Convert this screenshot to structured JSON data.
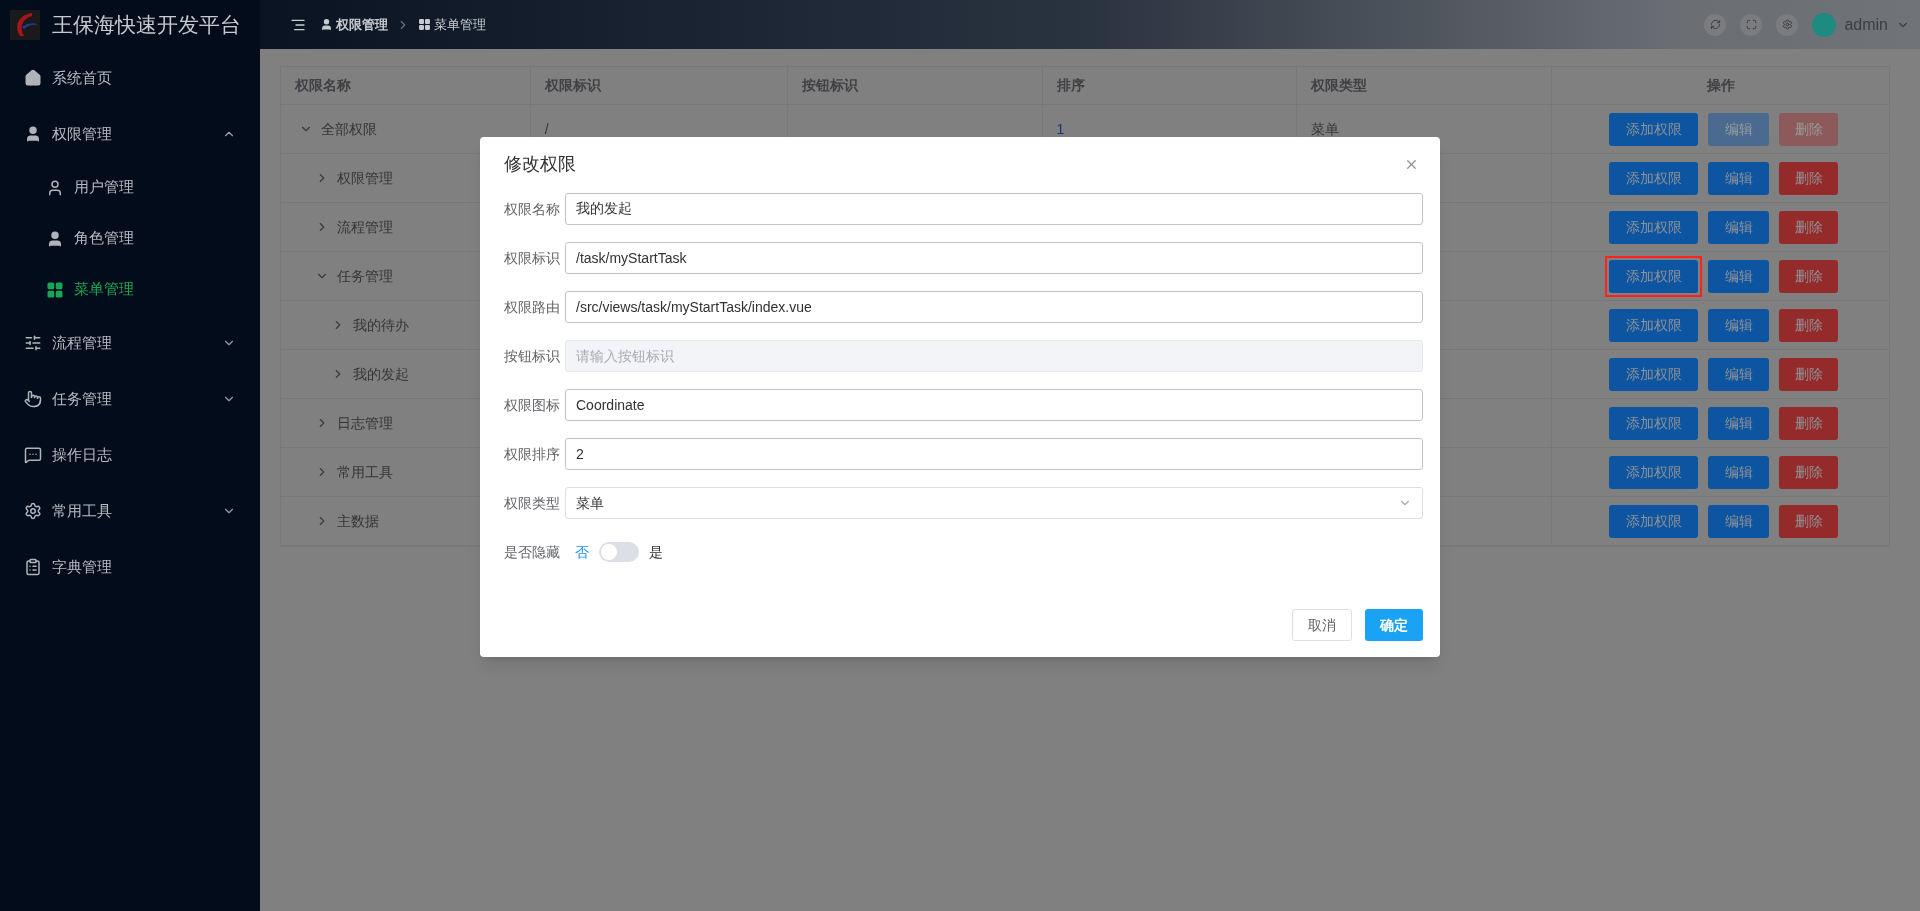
{
  "app": {
    "title": "王保海快速开发平台"
  },
  "header": {
    "breadcrumb": [
      "权限管理",
      "菜单管理"
    ],
    "user": "admin"
  },
  "sidebar": {
    "items": [
      {
        "label": "系统首页",
        "selected": false
      },
      {
        "label": "权限管理",
        "selected": false,
        "expanded": true,
        "children": [
          {
            "label": "用户管理",
            "selected": false
          },
          {
            "label": "角色管理",
            "selected": false
          },
          {
            "label": "菜单管理",
            "selected": true
          }
        ]
      },
      {
        "label": "流程管理",
        "selected": false,
        "expanded": false
      },
      {
        "label": "任务管理",
        "selected": false,
        "expanded": false
      },
      {
        "label": "操作日志",
        "selected": false
      },
      {
        "label": "常用工具",
        "selected": false,
        "expanded": false
      },
      {
        "label": "字典管理",
        "selected": false
      }
    ]
  },
  "table": {
    "columns": [
      "权限名称",
      "权限标识",
      "按钮标识",
      "排序",
      "权限类型",
      "操作"
    ],
    "rows": [
      {
        "name": "全部权限",
        "path": "/",
        "sort": "1",
        "type": "菜单",
        "expanded": true,
        "actions": [
          {
            "label": "添加权限",
            "kind": "add",
            "disabled": false,
            "highlighted": false
          },
          {
            "label": "编辑",
            "kind": "edit",
            "disabled": true,
            "highlighted": false
          },
          {
            "label": "删除",
            "kind": "delete",
            "disabled": true,
            "highlighted": false
          }
        ],
        "children": [
          {
            "name": "权限管理",
            "expanded": false,
            "actions": [
              {
                "label": "添加权限",
                "kind": "add",
                "disabled": false,
                "highlighted": false
              },
              {
                "label": "编辑",
                "kind": "edit",
                "disabled": false,
                "highlighted": false
              },
              {
                "label": "删除",
                "kind": "delete",
                "disabled": false,
                "highlighted": false
              }
            ]
          },
          {
            "name": "流程管理",
            "expanded": false,
            "actions": [
              {
                "label": "添加权限",
                "kind": "add",
                "disabled": false,
                "highlighted": false
              },
              {
                "label": "编辑",
                "kind": "edit",
                "disabled": false,
                "highlighted": false
              },
              {
                "label": "删除",
                "kind": "delete",
                "disabled": false,
                "highlighted": false
              }
            ]
          },
          {
            "name": "任务管理",
            "expanded": true,
            "actions": [
              {
                "label": "添加权限",
                "kind": "add",
                "disabled": false,
                "highlighted": true
              },
              {
                "label": "编辑",
                "kind": "edit",
                "disabled": false,
                "highlighted": false
              },
              {
                "label": "删除",
                "kind": "delete",
                "disabled": false,
                "highlighted": false
              }
            ],
            "children": [
              {
                "name": "我的待办",
                "expanded": false,
                "actions": [
                  {
                    "label": "添加权限",
                    "kind": "add",
                    "disabled": false,
                    "highlighted": false
                  },
                  {
                    "label": "编辑",
                    "kind": "edit",
                    "disabled": false,
                    "highlighted": false
                  },
                  {
                    "label": "删除",
                    "kind": "delete",
                    "disabled": false,
                    "highlighted": false
                  }
                ]
              },
              {
                "name": "我的发起",
                "expanded": false,
                "actions": [
                  {
                    "label": "添加权限",
                    "kind": "add",
                    "disabled": false,
                    "highlighted": false
                  },
                  {
                    "label": "编辑",
                    "kind": "edit",
                    "disabled": false,
                    "highlighted": false
                  },
                  {
                    "label": "删除",
                    "kind": "delete",
                    "disabled": false,
                    "highlighted": false
                  }
                ]
              }
            ]
          },
          {
            "name": "日志管理",
            "expanded": false,
            "actions": [
              {
                "label": "添加权限",
                "kind": "add",
                "disabled": false,
                "highlighted": false
              },
              {
                "label": "编辑",
                "kind": "edit",
                "disabled": false,
                "highlighted": false
              },
              {
                "label": "删除",
                "kind": "delete",
                "disabled": false,
                "highlighted": false
              }
            ]
          },
          {
            "name": "常用工具",
            "expanded": false,
            "actions": [
              {
                "label": "添加权限",
                "kind": "add",
                "disabled": false,
                "highlighted": false
              },
              {
                "label": "编辑",
                "kind": "edit",
                "disabled": false,
                "highlighted": false
              },
              {
                "label": "删除",
                "kind": "delete",
                "disabled": false,
                "highlighted": false
              }
            ]
          },
          {
            "name": "主数据",
            "expanded": false,
            "actions": [
              {
                "label": "添加权限",
                "kind": "add",
                "disabled": false,
                "highlighted": false
              },
              {
                "label": "编辑",
                "kind": "edit",
                "disabled": false,
                "highlighted": false
              },
              {
                "label": "删除",
                "kind": "delete",
                "disabled": false,
                "highlighted": false
              }
            ]
          }
        ]
      }
    ]
  },
  "dialog": {
    "title": "修改权限",
    "fields": [
      {
        "label": "权限名称",
        "kind": "input",
        "value": "我的发起",
        "disabled": false
      },
      {
        "label": "权限标识",
        "kind": "input",
        "value": "/task/myStartTask",
        "disabled": false
      },
      {
        "label": "权限路由",
        "kind": "input",
        "value": "/src/views/task/myStartTask/index.vue",
        "disabled": false
      },
      {
        "label": "按钮标识",
        "kind": "input",
        "placeholder": "请输入按钮标识",
        "disabled": true
      },
      {
        "label": "权限图标",
        "kind": "input",
        "value": "Coordinate",
        "disabled": false
      },
      {
        "label": "权限排序",
        "kind": "input",
        "value": "2",
        "disabled": false
      },
      {
        "label": "权限类型",
        "kind": "select",
        "value": "菜单",
        "disabled": false
      }
    ],
    "switch": {
      "label": "是否隐藏",
      "off_label": "否",
      "on_label": "是",
      "on": false
    },
    "buttons": [
      {
        "label": "取消",
        "kind": "default"
      },
      {
        "label": "确定",
        "kind": "primary"
      }
    ]
  }
}
